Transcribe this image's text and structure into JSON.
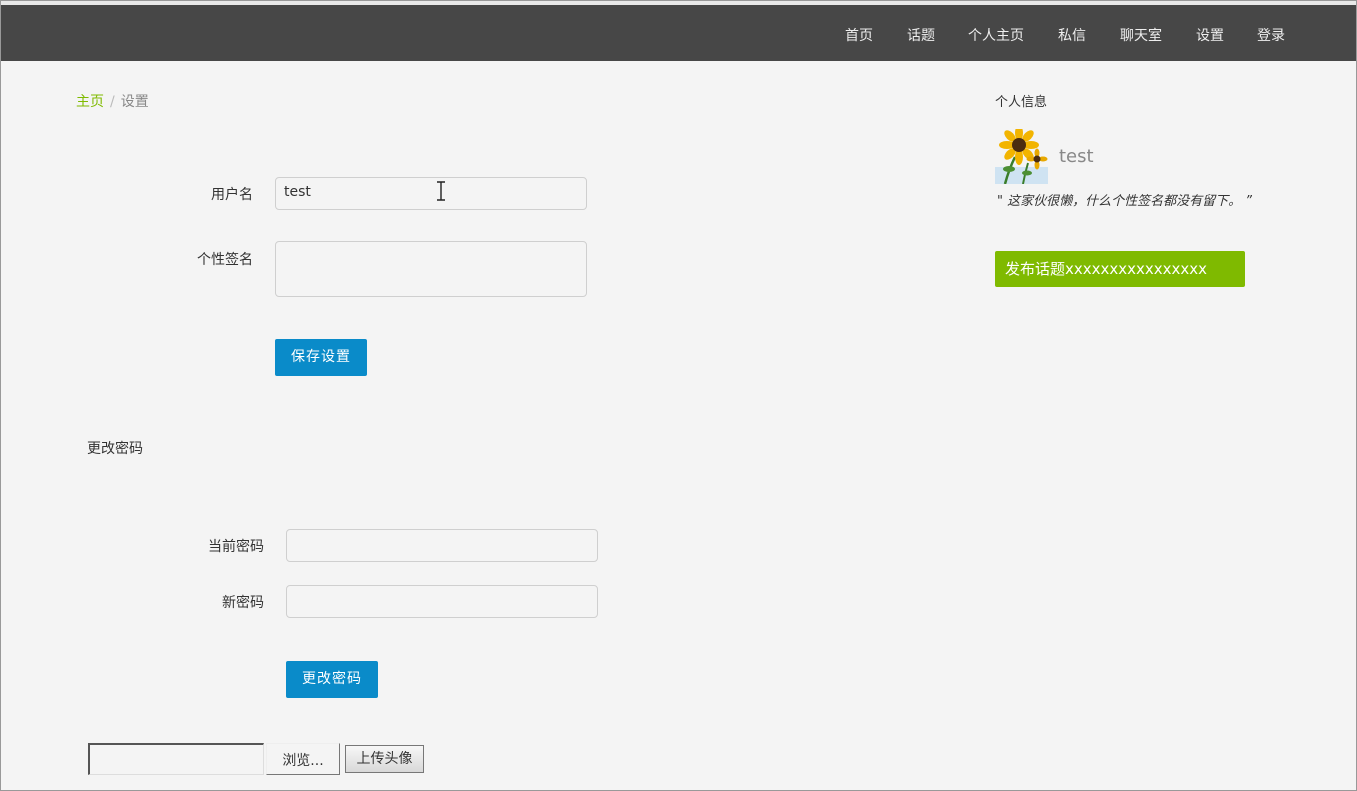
{
  "nav": {
    "items": [
      "首页",
      "话题",
      "个人主页",
      "私信",
      "聊天室",
      "设置",
      "登录"
    ]
  },
  "breadcrumb": {
    "home": "主页",
    "separator": "/",
    "current": "设置"
  },
  "profile_form": {
    "username_label": "用户名",
    "username_value": "test",
    "signature_label": "个性签名",
    "signature_value": "",
    "save_label": "保存设置"
  },
  "password_form": {
    "title": "更改密码",
    "current_label": "当前密码",
    "new_label": "新密码",
    "submit_label": "更改密码"
  },
  "upload": {
    "browse_label": "浏览...",
    "upload_label": "上传头像"
  },
  "sidebar": {
    "title": "个人信息",
    "username": "test",
    "signature": "\" 这家伙很懒，什么个性签名都没有留下。 ”",
    "publish_label": "发布话题xxxxxxxxxxxxxxxx"
  },
  "colors": {
    "navbar": "#474747",
    "accent_green": "#7fba00",
    "accent_blue": "#0a8bc9"
  }
}
